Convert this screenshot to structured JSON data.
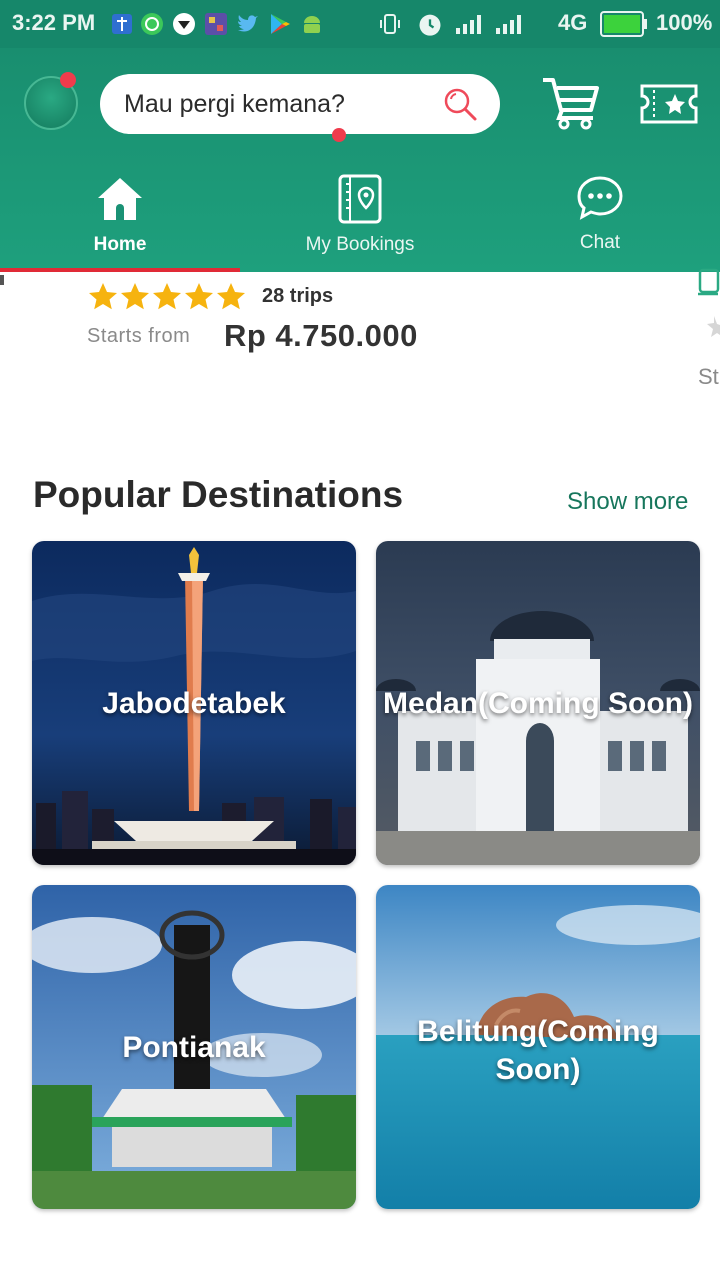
{
  "status_bar": {
    "time": "3:22 PM",
    "network": "4G",
    "battery": "100%",
    "icons": [
      "shield-icon",
      "whatsapp-icon",
      "vpn-icon",
      "game-icon",
      "twitter-icon",
      "play-store-icon",
      "android-icon",
      "vibrate-icon",
      "alarm-icon",
      "signal-icon",
      "signal-icon",
      "battery-icon"
    ]
  },
  "header": {
    "search_placeholder": "Mau pergi kemana?",
    "tabs": [
      {
        "label": "Home",
        "icon": "home-icon",
        "active": true
      },
      {
        "label": "My Bookings",
        "icon": "bookings-icon",
        "active": false
      },
      {
        "label": "Chat",
        "icon": "chat-icon",
        "active": false
      }
    ]
  },
  "trip_card": {
    "rating": 5,
    "trips": "28 trips",
    "starts_from_label": "Starts from",
    "price": "Rp 4.750.000",
    "peek_text": "St"
  },
  "popular": {
    "title": "Popular Destinations",
    "show_more": "Show more",
    "destinations": [
      {
        "name": "Jabodetabek"
      },
      {
        "name": "Medan(Coming Soon)"
      },
      {
        "name": "Pontianak"
      },
      {
        "name": "Belitung(Coming Soon)"
      }
    ]
  },
  "colors": {
    "primary": "#1a9275",
    "accent_red": "#e02a36",
    "star": "#f6b30f",
    "link": "#17765c"
  }
}
